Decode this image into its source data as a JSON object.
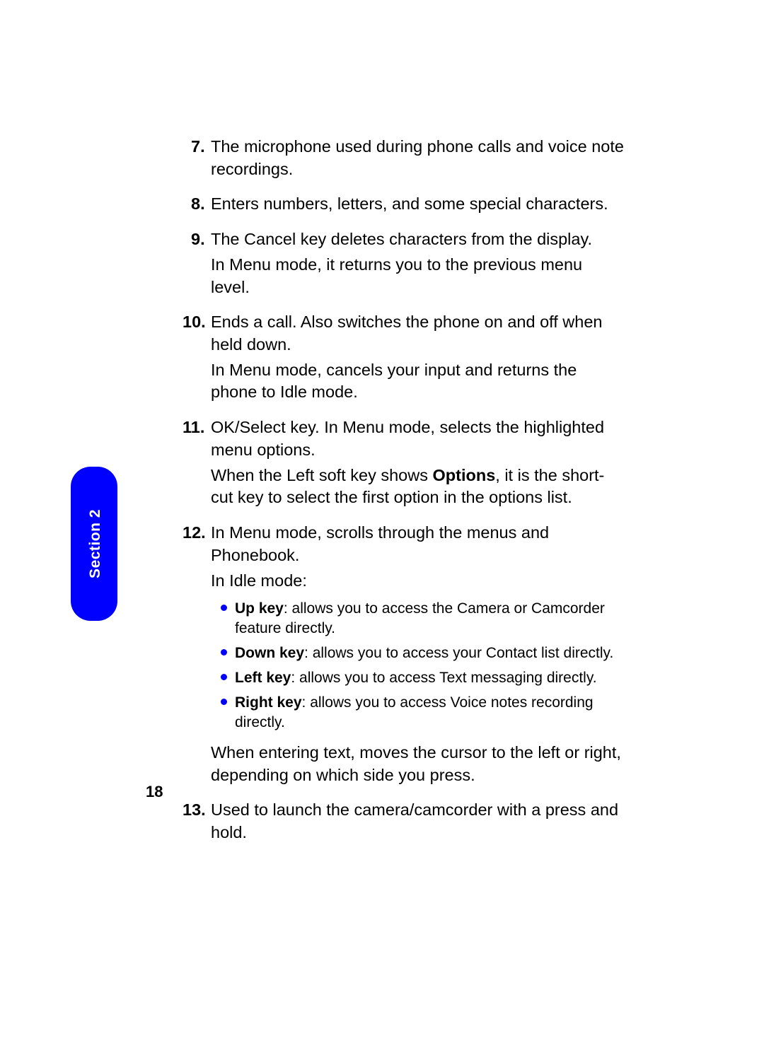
{
  "section_label": "Section 2",
  "page_number": "18",
  "items": [
    {
      "num": "7.",
      "text": "The microphone used during phone calls and voice note recordings."
    },
    {
      "num": "8.",
      "text": "Enters numbers, letters, and some special characters."
    },
    {
      "num": "9.",
      "paras": [
        "The Cancel key deletes characters from the display.",
        "In Menu mode, it returns you to the previous menu level."
      ]
    },
    {
      "num": "10.",
      "paras": [
        "Ends a call. Also switches the phone on and off when held down.",
        "In Menu mode, cancels your input and returns the phone to Idle mode."
      ]
    },
    {
      "num": "11.",
      "paras_html": [
        [
          {
            "t": "OK/Select key. In Menu mode, selects the highlighted menu options."
          }
        ],
        [
          {
            "t": "When the Left soft key shows "
          },
          {
            "b": "Options"
          },
          {
            "t": ", it is the short-cut key to select the first option in the options list."
          }
        ]
      ]
    },
    {
      "num": "12.",
      "top": "In Menu mode, scrolls through the menus and Phonebook.",
      "lead": "In Idle mode:",
      "bullets": [
        {
          "label": "Up key",
          "text": ": allows you to access the Camera or Camcorder feature directly."
        },
        {
          "label": "Down key",
          "text": ": allows you to access your Contact list directly."
        },
        {
          "label": "Left key",
          "text": ": allows you to access Text messaging directly."
        },
        {
          "label": "Right key",
          "text": ": allows you to access Voice notes recording directly."
        }
      ],
      "tail": "When entering text, moves the cursor to the left or right, depending on which side you press."
    },
    {
      "num": "13.",
      "text": "Used to launch the camera/camcorder with a press and hold."
    }
  ]
}
